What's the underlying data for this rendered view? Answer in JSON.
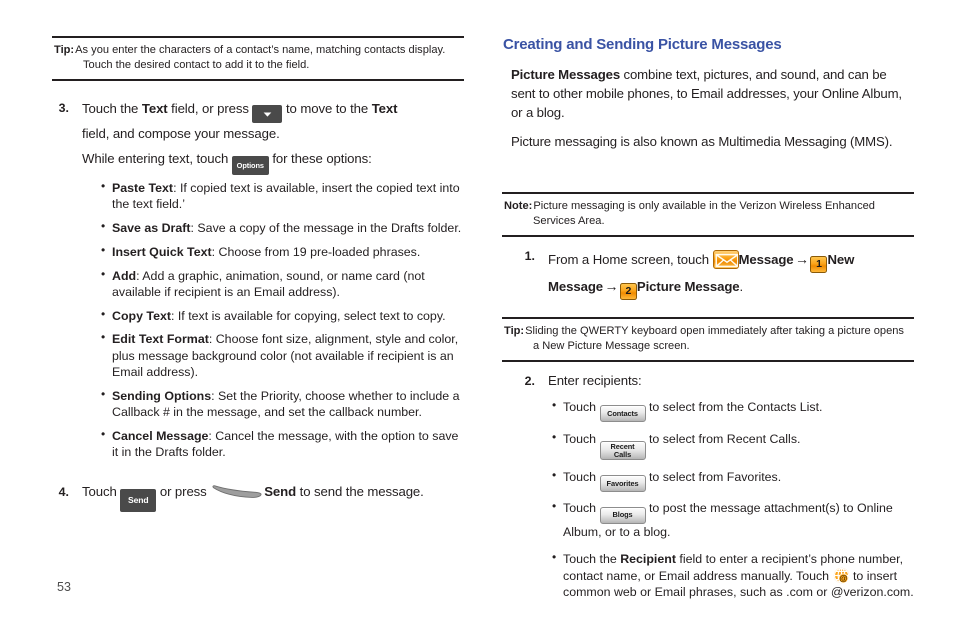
{
  "meta": {
    "page_number": "53",
    "accent_heading_color": "#3a53a4",
    "badge_color": "#fba41a",
    "keycap_color": "#4a4a4a"
  },
  "left_column": {
    "tip_top": {
      "label": "Tip:",
      "text": "As you enter the characters of a contact’s name, matching contacts display.  Touch the desired contact to add it to the field."
    },
    "step3": {
      "number": "3.",
      "line1_a": "Touch the ",
      "line1_bold1": "Text",
      "line1_b": " field, or press ",
      "key_arrow": "▼",
      "line1_c": " to move to the ",
      "line1_bold2": "Text",
      "line2": "field, and compose your message.",
      "line3_a": "While entering text, touch ",
      "key_options": "Options",
      "line3_b": " for these options:",
      "options": [
        {
          "term": "Paste Text",
          "desc": ": If copied text is available, insert the copied text into the text field.’"
        },
        {
          "term": "Save as Draft",
          "desc": ": Save a copy of the message in the Drafts folder."
        },
        {
          "term": "Insert Quick Text",
          "desc": ": Choose from 19 pre-loaded phrases."
        },
        {
          "term": "Add",
          "desc": ": Add a graphic, animation, sound, or name card (not available if recipient is an Email address)."
        },
        {
          "term": "Copy Text",
          "desc": ": If text is available for copying, select text to copy."
        },
        {
          "term": "Edit Text Format",
          "desc": ": Choose font size, alignment, style and color, plus message background color (not available if recipient is an Email address)."
        },
        {
          "term": "Sending Options",
          "desc": ": Set the Priority, choose whether to include a Callback # in the message, and set the callback number."
        },
        {
          "term": "Cancel Message",
          "desc": ": Cancel the message, with the option to save it in the Drafts folder."
        }
      ]
    },
    "step4": {
      "number": "4.",
      "text_a": "Touch ",
      "key_send": "Send",
      "text_b": " or press ",
      "softkey_name": "send-soft-key",
      "text_c": "Send",
      "text_d": " to send the message."
    }
  },
  "right_column": {
    "heading": "Creating and Sending Picture Messages",
    "para1_bold": "Picture Messages",
    "para1_rest": " combine text, pictures, and sound, and can be sent to other mobile phones, to Email addresses, your Online Album, or a  blog.",
    "para2": "Picture messaging is also known as Multimedia Messaging (MMS).",
    "note": {
      "label": "Note:",
      "text": "Picture messaging is only available in the Verizon Wireless Enhanced Services Area."
    },
    "step1": {
      "number": "1.",
      "text_a": "From a Home screen, touch ",
      "icon_message": "message-envelope-icon",
      "label_message": "Message",
      "arrow1": "→",
      "badge1": "1",
      "label_new_message": "New Message",
      "arrow2": "→",
      "badge2": "2",
      "label_picture_message": "Picture Message",
      "period": "."
    },
    "tip_bottom": {
      "label": "Tip:",
      "text": "Sliding the QWERTY keyboard open immediately after taking a picture opens a New Picture Message screen."
    },
    "step2": {
      "number": "2.",
      "text": "Enter recipients:",
      "bullets": [
        {
          "pre": "Touch ",
          "button": "Contacts",
          "button_lines": [
            "Contacts"
          ],
          "post": " to select from the Contacts List."
        },
        {
          "pre": "Touch ",
          "button": "Recent Calls",
          "button_lines": [
            "Recent",
            "Calls"
          ],
          "post": " to select from Recent Calls."
        },
        {
          "pre": "Touch ",
          "button": "Favorites",
          "button_lines": [
            "Favorites"
          ],
          "post": " to select from Favorites."
        },
        {
          "pre": "Touch ",
          "button": "Blogs",
          "button_lines": [
            "Blogs"
          ],
          "post": " to post the message attachment(s) to Online Album, or to a blog."
        }
      ],
      "recipient_bullet": {
        "pre": "Touch the ",
        "bold": "Recipient",
        "mid": " field to enter a recipient’s phone number, contact name, or Email address manually. Touch ",
        "icon": "globe-at-icon",
        "post": " to insert common web or Email phrases, such as .com or @verizon.com."
      }
    }
  }
}
